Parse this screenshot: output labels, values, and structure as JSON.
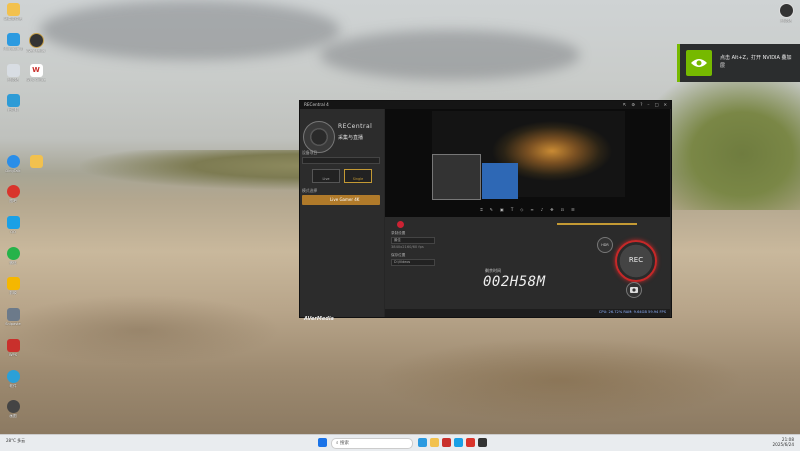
{
  "desktop": {
    "icons": [
      {
        "label": "新建文件夹",
        "color": "#2e6fd0"
      },
      {
        "label": "Microsoft Edge",
        "color": "#2b9ae0"
      },
      {
        "label": "回收站",
        "color": "#1a6fd0"
      },
      {
        "label": "此电脑",
        "color": "#2d9bd6"
      },
      {
        "label": "DingTalk",
        "color": "#2a8ee8"
      },
      {
        "label": "图吧",
        "color": "#d9342b"
      },
      {
        "label": "QQ",
        "color": "#1aa0e6"
      },
      {
        "label": "微信",
        "color": "#26b34a"
      },
      {
        "label": "剪映",
        "color": "#f5b700"
      },
      {
        "label": "Snipaste",
        "color": "#6c7a8a"
      },
      {
        "label": "WPS",
        "color": "#c9302c"
      },
      {
        "label": "软件",
        "color": "#2ca0d8"
      },
      {
        "label": "画图",
        "color": "#444"
      }
    ],
    "right_icon_label": "回收站",
    "col2_labels": [
      "AVerMedia RECentral 4",
      "WPS Office"
    ]
  },
  "notification": {
    "text": "点击 Alt+Z，打开 NVIDIA 叠加层"
  },
  "app": {
    "title": "RECentral 4",
    "brand": "RECentral",
    "subtitle": "采集与直播",
    "sections": {
      "video_source": "设备项目",
      "mode": "模式选择"
    },
    "sources": [
      "Live",
      "Single"
    ],
    "mode_button": "Live Gamer 4K",
    "vendor_logo": "AVerMedia",
    "controls": {
      "record_label": "录制设置",
      "quality_value": "最佳",
      "resolution_value": "3840x2160/60 fps",
      "path_label": "保存位置",
      "path_value": "D:\\Videos"
    },
    "timer_label": "剩余时间",
    "timer_value": "002H58M",
    "hdr_label": "HDR",
    "rec_label": "REC",
    "camera_glyph": "⌷",
    "status_text": "CPU: 26.72%  RAM: 9.64GB  59.94 FPS"
  },
  "taskbar": {
    "weather": "28°C 多云",
    "search_placeholder": "搜索",
    "time": "21:08",
    "date": "2025/6/24"
  }
}
